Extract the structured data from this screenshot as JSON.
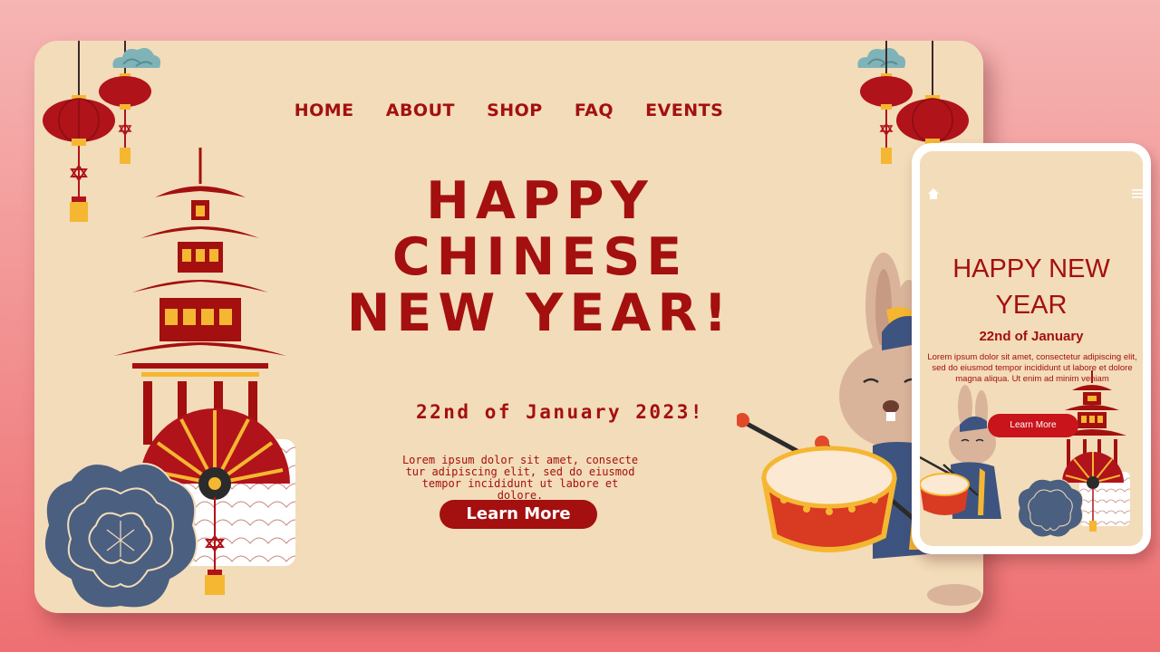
{
  "nav": {
    "items": [
      {
        "label": "HOME"
      },
      {
        "label": "ABOUT"
      },
      {
        "label": "SHOP"
      },
      {
        "label": "FAQ"
      },
      {
        "label": "EVENTS"
      }
    ]
  },
  "hero": {
    "title_line1": "HAPPY",
    "title_line2": "CHINESE",
    "title_line3": "NEW YEAR!",
    "date": "22nd of January 2023!",
    "body_line1": "Lorem ipsum dolor sit amet, consecte",
    "body_line2": "tur adipiscing elit, sed do eiusmod",
    "body_line3": "tempor incididunt ut labore et dolore.",
    "cta_label": "Learn More"
  },
  "mobile": {
    "title_line1": "HAPPY NEW",
    "title_line2": "YEAR",
    "date": "22nd of January",
    "body": "Lorem ipsum dolor sit amet, consectetur adipiscing elit, sed do eiusmod tempor incididunt ut labore et dolore magna aliqua. Ut enim ad minim veniam",
    "cta_label": "Learn More"
  },
  "colors": {
    "page_bg": "#f28f8f",
    "card_bg": "#f3dcb9",
    "accent_red": "#a3100f",
    "gold": "#f5b731",
    "navy": "#4b5f80",
    "cloud_teal": "#7fb3b8"
  },
  "icons": [
    "lantern-icon",
    "cloud-icon",
    "pagoda-icon",
    "fan-icon",
    "peony-flower-icon",
    "rabbit-drummer-icon",
    "drum-icon",
    "home-icon",
    "hamburger-menu-icon"
  ]
}
